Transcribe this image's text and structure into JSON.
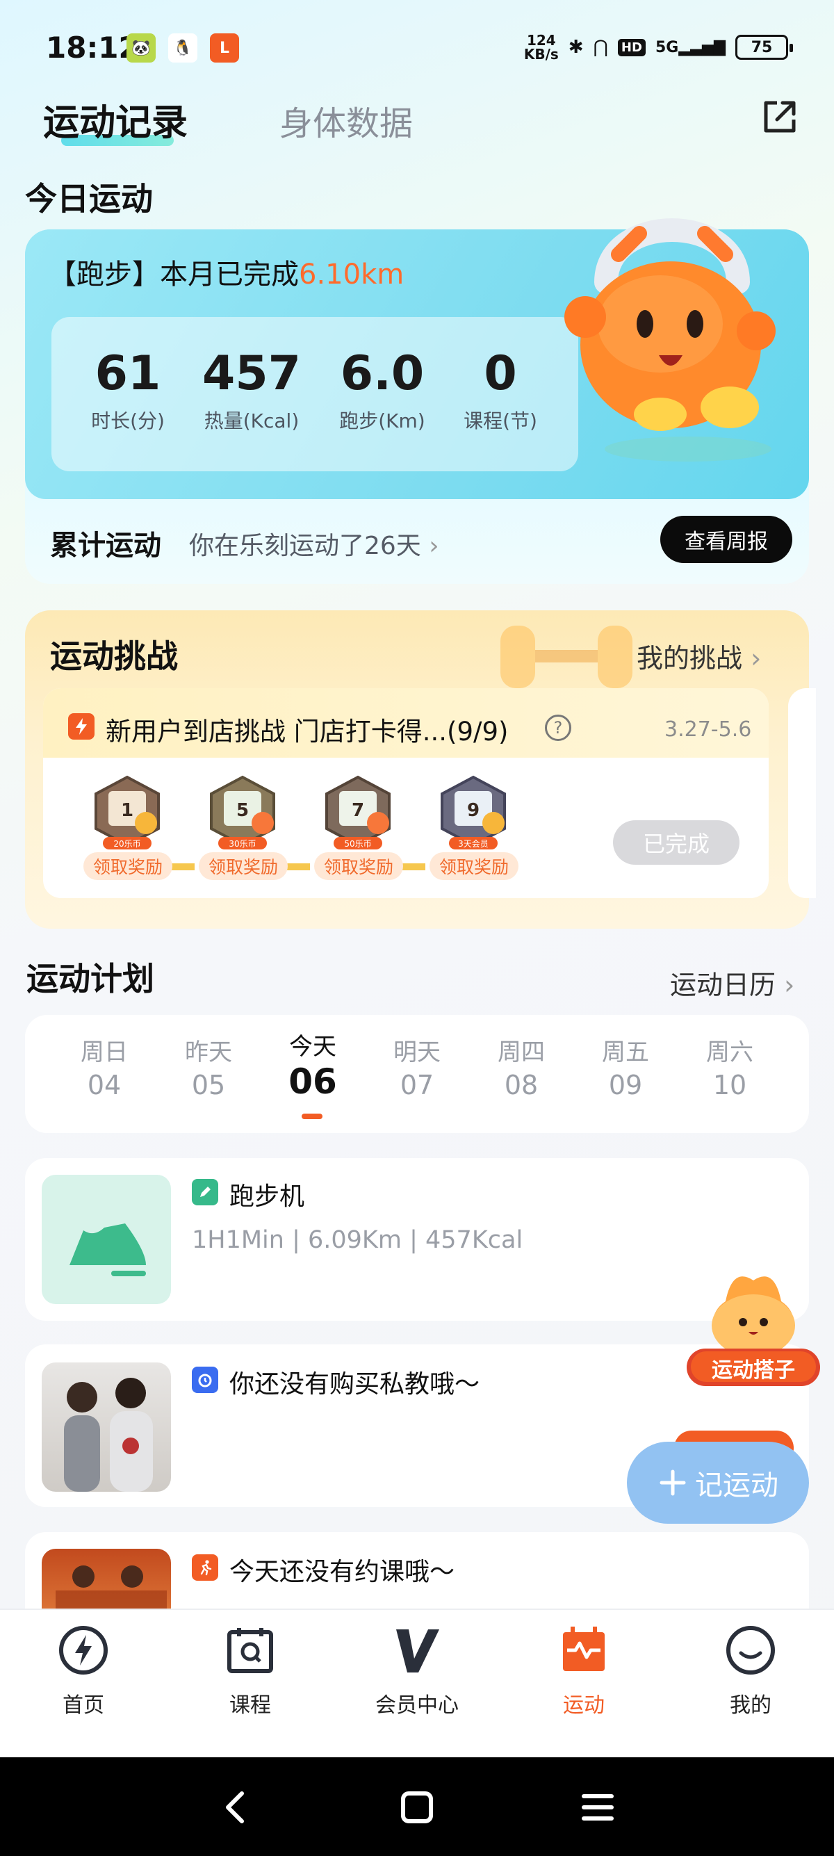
{
  "status_bar": {
    "time": "18:12",
    "net_speed_top": "124",
    "net_speed_bottom": "KB/s",
    "hd_label": "HD",
    "signal_label": "5G",
    "battery": "75"
  },
  "top_tabs": {
    "active": "运动记录",
    "inactive": "身体数据"
  },
  "today": {
    "section_title": "今日运动",
    "month_prefix": "【跑步】本月已完成",
    "month_value": "6.10km",
    "stats": [
      {
        "value": "61",
        "label": "时长(分)"
      },
      {
        "value": "457",
        "label": "热量(Kcal)"
      },
      {
        "value": "6.0",
        "label": "跑步(Km)"
      },
      {
        "value": "0",
        "label": "课程(节)"
      }
    ],
    "total_label": "累计运动",
    "total_desc": "你在乐刻运动了26天",
    "weekly_button": "查看周报"
  },
  "challenge": {
    "section_title": "运动挑战",
    "my_link": "我的挑战",
    "name": "新用户到店挑战 门店打卡得...(9/9)",
    "date_range": "3.27-5.6",
    "badges": [
      {
        "digit": "1",
        "caption": "20乐币",
        "reward": "领取奖励"
      },
      {
        "digit": "5",
        "caption": "30乐币",
        "reward": "领取奖励"
      },
      {
        "digit": "7",
        "caption": "50乐币",
        "reward": "领取奖励"
      },
      {
        "digit": "9",
        "caption": "3天会员",
        "reward": "领取奖励"
      }
    ],
    "done_button": "已完成"
  },
  "plan": {
    "section_title": "运动计划",
    "calendar_link": "运动日历",
    "days": [
      {
        "name": "周日",
        "date": "04"
      },
      {
        "name": "昨天",
        "date": "05"
      },
      {
        "name": "今天",
        "date": "06"
      },
      {
        "name": "明天",
        "date": "07"
      },
      {
        "name": "周四",
        "date": "08"
      },
      {
        "name": "周五",
        "date": "09"
      },
      {
        "name": "周六",
        "date": "10"
      }
    ],
    "cards": [
      {
        "title": "跑步机",
        "subtitle": "1H1Min | 6.09Km | 457Kcal"
      },
      {
        "title": "你还没有购买私教哦～"
      },
      {
        "title": "今天还没有约课哦～"
      }
    ]
  },
  "floating": {
    "partner_label": "运动搭子",
    "record_button": "记运动"
  },
  "tabbar": [
    {
      "label": "首页",
      "icon": "lightning-icon"
    },
    {
      "label": "课程",
      "icon": "calendar-course-icon"
    },
    {
      "label": "会员中心",
      "icon": "v-logo-icon"
    },
    {
      "label": "运动",
      "icon": "sport-calendar-icon"
    },
    {
      "label": "我的",
      "icon": "smile-icon"
    }
  ],
  "colors": {
    "accent": "#f25c24",
    "highlight": "#ff6a2b",
    "record_button": "#92c2f2"
  }
}
